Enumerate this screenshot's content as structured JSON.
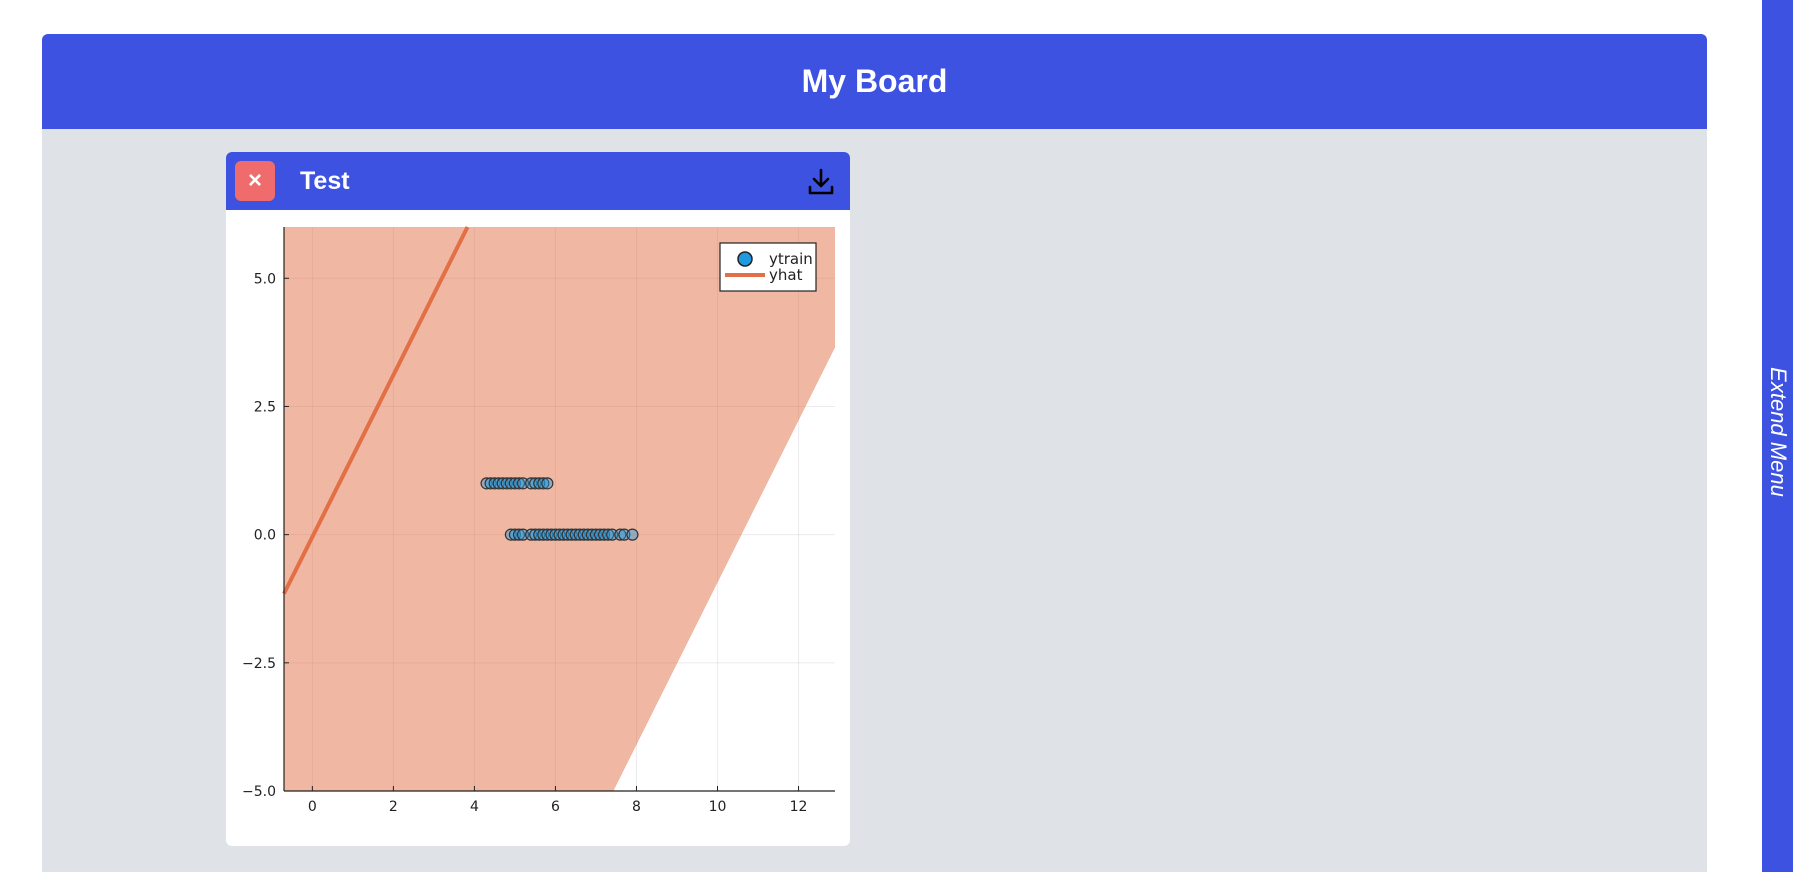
{
  "board": {
    "title": "My Board"
  },
  "sidebar": {
    "extend_label": "Extend Menu"
  },
  "card": {
    "title": "Test",
    "close_label": "×",
    "close_icon": "close-icon",
    "download_icon": "download-icon"
  },
  "chart_data": {
    "type": "scatter",
    "title": "",
    "xlabel": "",
    "ylabel": "",
    "xlim": [
      -0.7,
      12.9
    ],
    "ylim": [
      -5,
      6
    ],
    "xticks": [
      0,
      2,
      4,
      6,
      8,
      10,
      12
    ],
    "xtick_labels": [
      "0",
      "2",
      "4",
      "6",
      "8",
      "10",
      "12"
    ],
    "yticks": [
      -5,
      -2.5,
      0,
      2.5,
      5
    ],
    "ytick_labels": [
      "−5.0",
      "−2.5",
      "0.0",
      "2.5",
      "5.0"
    ],
    "grid": true,
    "legend_position": "top-right",
    "series": [
      {
        "name": "ytrain",
        "kind": "scatter",
        "color": "#1f9ae0",
        "points": [
          [
            4.3,
            1
          ],
          [
            4.4,
            1
          ],
          [
            4.5,
            1
          ],
          [
            4.6,
            1
          ],
          [
            4.7,
            1
          ],
          [
            4.8,
            1
          ],
          [
            4.9,
            1
          ],
          [
            5.0,
            1
          ],
          [
            5.1,
            1
          ],
          [
            5.2,
            1
          ],
          [
            5.4,
            1
          ],
          [
            5.5,
            1
          ],
          [
            5.6,
            1
          ],
          [
            5.7,
            1
          ],
          [
            5.8,
            1
          ],
          [
            4.9,
            0
          ],
          [
            5.0,
            0
          ],
          [
            5.1,
            0
          ],
          [
            5.2,
            0
          ],
          [
            5.4,
            0
          ],
          [
            5.5,
            0
          ],
          [
            5.6,
            0
          ],
          [
            5.7,
            0
          ],
          [
            5.8,
            0
          ],
          [
            5.9,
            0
          ],
          [
            6.0,
            0
          ],
          [
            6.1,
            0
          ],
          [
            6.2,
            0
          ],
          [
            6.3,
            0
          ],
          [
            6.4,
            0
          ],
          [
            6.5,
            0
          ],
          [
            6.6,
            0
          ],
          [
            6.7,
            0
          ],
          [
            6.8,
            0
          ],
          [
            6.9,
            0
          ],
          [
            7.0,
            0
          ],
          [
            7.1,
            0
          ],
          [
            7.2,
            0
          ],
          [
            7.3,
            0
          ],
          [
            7.4,
            0
          ],
          [
            7.6,
            0
          ],
          [
            7.7,
            0
          ],
          [
            7.9,
            0
          ]
        ]
      },
      {
        "name": "yhat",
        "kind": "line",
        "color": "#e26f46",
        "line": [
          [
            -0.7,
            -1.15
          ],
          [
            3.83,
            6.0
          ]
        ],
        "band": {
          "color": "#e26f46",
          "opacity": 0.5,
          "upper": [
            [
              -0.7,
              6.0
            ],
            [
              12.9,
              6.0
            ]
          ],
          "lower": [
            [
              -0.7,
              -5.0
            ],
            [
              7.43,
              -5.0
            ],
            [
              12.9,
              3.65
            ]
          ]
        }
      }
    ]
  }
}
